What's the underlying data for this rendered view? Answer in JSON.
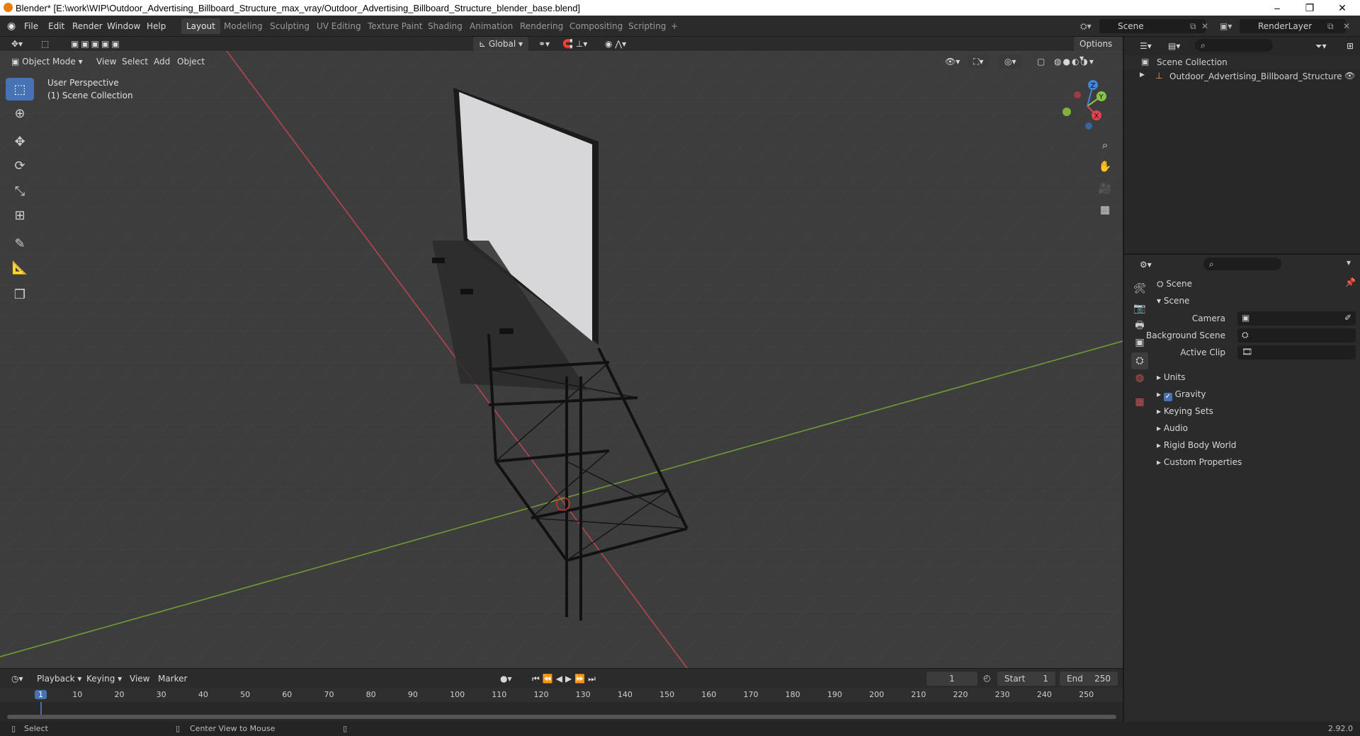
{
  "window": {
    "title": "Blender* [E:\\work\\WIP\\Outdoor_Advertising_Billboard_Structure_max_vray/Outdoor_Advertising_Billboard_Structure_blender_base.blend]",
    "minimize": "–",
    "restore": "❐",
    "close": "✕"
  },
  "menu": [
    "File",
    "Edit",
    "Render",
    "Window",
    "Help"
  ],
  "workspaces": [
    "Layout",
    "Modeling",
    "Sculpting",
    "UV Editing",
    "Texture Paint",
    "Shading",
    "Animation",
    "Rendering",
    "Compositing",
    "Scripting",
    "+"
  ],
  "active_workspace": "Layout",
  "scene_field": "Scene",
  "renderlayer_field": "RenderLayer",
  "viewport_header": {
    "mode": "Object Mode",
    "menus": [
      "View",
      "Select",
      "Add",
      "Object"
    ],
    "orientation": "Global",
    "options": "Options"
  },
  "viewport": {
    "perspective": "User Perspective",
    "collection": "(1) Scene Collection"
  },
  "gizmo": {
    "x": "X",
    "y": "Y",
    "z": "Z"
  },
  "outliner": {
    "root": "Scene Collection",
    "items": [
      "Outdoor_Advertising_Billboard_Structure"
    ]
  },
  "properties": {
    "context": "Scene",
    "panel": "Scene",
    "fields": [
      {
        "label": "Camera"
      },
      {
        "label": "Background Scene"
      },
      {
        "label": "Active Clip"
      }
    ],
    "subpanels": [
      "Units",
      "Gravity",
      "Keying Sets",
      "Audio",
      "Rigid Body World",
      "Custom Properties"
    ],
    "gravity_checked": true
  },
  "timeline": {
    "menus": [
      "Playback",
      "Keying",
      "View",
      "Marker"
    ],
    "current_frame": "1",
    "start_label": "Start",
    "start": "1",
    "end_label": "End",
    "end": "250",
    "ticks": [
      "1",
      "10",
      "20",
      "30",
      "40",
      "50",
      "60",
      "70",
      "80",
      "90",
      "100",
      "110",
      "120",
      "130",
      "140",
      "150",
      "160",
      "170",
      "180",
      "190",
      "200",
      "210",
      "220",
      "230",
      "240",
      "250"
    ]
  },
  "status": {
    "left": "Select",
    "mid": "Center View to Mouse",
    "version": "2.92.0"
  },
  "colors": {
    "accent": "#4772b3",
    "x_axis": "#e0434f",
    "y_axis": "#8ac349",
    "z_axis": "#3f85d9"
  }
}
